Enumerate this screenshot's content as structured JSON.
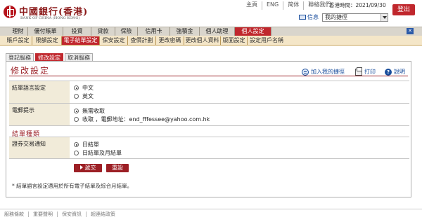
{
  "header": {
    "logo_cn": "中國銀行(香港)",
    "logo_en": "BANK OF CHINA (HONG KONG)",
    "top_links": [
      "主頁",
      "ENG",
      "简体",
      "聯絡我們"
    ],
    "hk_time_label": "香港時間：",
    "hk_time_value": "2021/09/30",
    "logout_label": "登出",
    "message_label": "信息",
    "shortcut_selected": "我的捷徑"
  },
  "main_nav": {
    "items": [
      "理財",
      "優付賬單",
      "投資",
      "貸款",
      "保險",
      "信用卡",
      "強積金",
      "個人助理",
      "個人設定"
    ],
    "active_index": 8
  },
  "sub_nav": {
    "items": [
      "賬戶設定",
      "限額設定",
      "電子結單設定",
      "保安設定",
      "查價計劃",
      "更改密碼",
      "更改個人資料",
      "版面設定",
      "設定用戶名稱"
    ],
    "active_index": 2
  },
  "tabs": {
    "items": [
      "登記服務",
      "修改設定",
      "取消服務"
    ],
    "active_index": 1
  },
  "page": {
    "title": "修改設定",
    "actions": {
      "add_shortcut": "加入我的捷徑",
      "print": "打印",
      "help": "說明"
    }
  },
  "form": {
    "language": {
      "label": "結單語言設定",
      "options": [
        "中文",
        "英文"
      ],
      "selected_index": 0
    },
    "email_alert": {
      "label": "電郵提示",
      "options": [
        "無需收取",
        "收取 ，電郵地址：end_fffessee@yahoo.com.hk"
      ],
      "selected_index": 0
    },
    "statement_type_title": "結單種類",
    "securities_notice": {
      "label": "證券交易通知",
      "options": [
        "日結單",
        "日結單及月結單"
      ],
      "selected_index": 0
    },
    "submit_label": "遞交",
    "reset_label": "重設",
    "note": "* 結單語言設定適用於所有電子結單及綜合月結單。"
  },
  "footer": {
    "links": [
      "服務條款",
      "重要聲明",
      "保安資訊",
      "超連結政策"
    ]
  },
  "colors": {
    "brand_red": "#c0272d",
    "title_red": "#9c2228",
    "link_blue": "#1a4e9c",
    "label_bg": "#f1ebd9",
    "subnav_bg": "#f4e6c8"
  }
}
